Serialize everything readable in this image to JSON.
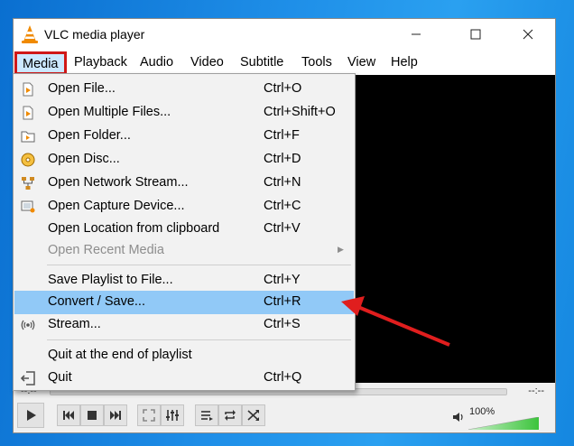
{
  "window": {
    "title": "VLC media player",
    "controls": [
      "minimize-icon",
      "maximize-icon",
      "close-icon"
    ]
  },
  "menubar": {
    "items": [
      "Media",
      "Playback",
      "Audio",
      "Video",
      "Subtitle",
      "Tools",
      "View",
      "Help"
    ],
    "active": "Media"
  },
  "media_menu": {
    "items": [
      {
        "label": "Open File...",
        "shortcut": "Ctrl+O",
        "icon": "file-icon"
      },
      {
        "label": "Open Multiple Files...",
        "shortcut": "Ctrl+Shift+O",
        "icon": "files-icon"
      },
      {
        "label": "Open Folder...",
        "shortcut": "Ctrl+F",
        "icon": "folder-icon"
      },
      {
        "label": "Open Disc...",
        "shortcut": "Ctrl+D",
        "icon": "disc-icon"
      },
      {
        "label": "Open Network Stream...",
        "shortcut": "Ctrl+N",
        "icon": "network-icon"
      },
      {
        "label": "Open Capture Device...",
        "shortcut": "Ctrl+C",
        "icon": "capture-device-icon"
      },
      {
        "label": "Open Location from clipboard",
        "shortcut": "Ctrl+V",
        "icon": ""
      },
      {
        "label": "Open Recent Media",
        "shortcut": "",
        "icon": "",
        "disabled": true,
        "submenu": true
      },
      {
        "label": "Save Playlist to File...",
        "shortcut": "Ctrl+Y",
        "icon": ""
      },
      {
        "label": "Convert / Save...",
        "shortcut": "Ctrl+R",
        "icon": "",
        "highlighted": true
      },
      {
        "label": "Stream...",
        "shortcut": "Ctrl+S",
        "icon": "stream-icon"
      },
      {
        "label": "Quit at the end of playlist",
        "shortcut": "",
        "icon": ""
      },
      {
        "label": "Quit",
        "shortcut": "Ctrl+Q",
        "icon": "quit-icon"
      }
    ]
  },
  "seek": {
    "time_left": "--:--",
    "time_right": "--:--"
  },
  "volume": {
    "percent_label": "100%",
    "level": 1.0
  },
  "colors": {
    "highlight": "#91c9f7",
    "annotation_red": "#e01e1e",
    "volume_green": "#3cc43c"
  }
}
